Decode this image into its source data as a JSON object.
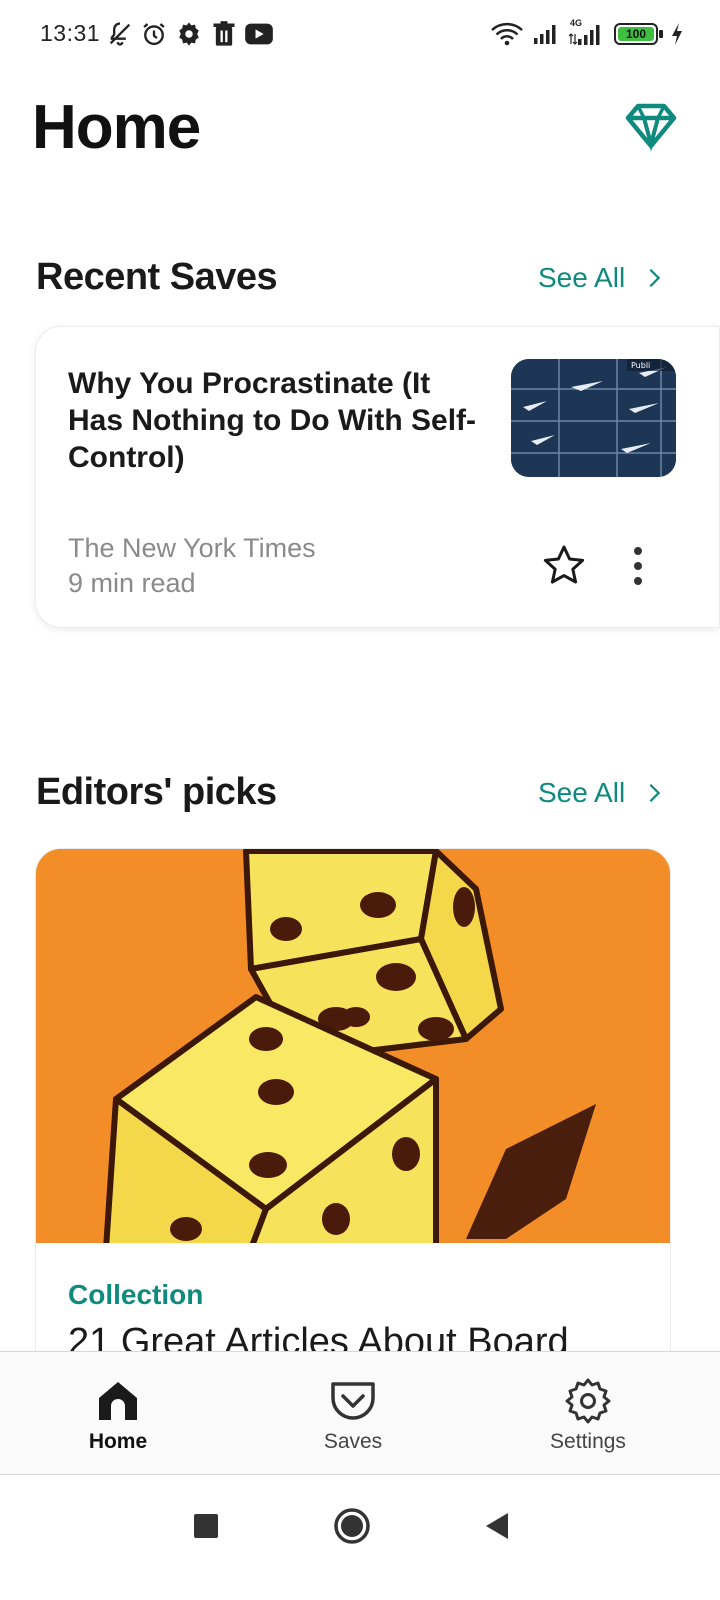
{
  "status_bar": {
    "time": "13:31",
    "battery": "100",
    "network": "4G",
    "icons": [
      "bell-off-icon",
      "alarm-icon",
      "settings-gear-icon",
      "trash-icon",
      "youtube-icon",
      "wifi-icon",
      "signal-icon",
      "signal-4g-icon",
      "battery-icon",
      "charging-icon"
    ]
  },
  "header": {
    "title": "Home",
    "premium_icon": "diamond-icon"
  },
  "recent_saves": {
    "title": "Recent Saves",
    "see_all": "See All",
    "item": {
      "title": "Why You Procrastinate (It Has Nothing to Do With Self-Control)",
      "source": "The New York Times",
      "read_time": "9 min read"
    }
  },
  "editors_picks": {
    "title": "Editors' picks",
    "see_all": "See All",
    "item": {
      "label": "Collection",
      "title": "21 Great Articles About Board"
    }
  },
  "bottom_nav": {
    "items": [
      {
        "label": "Home",
        "icon": "home-icon",
        "active": true
      },
      {
        "label": "Saves",
        "icon": "pocket-icon",
        "active": false
      },
      {
        "label": "Settings",
        "icon": "gear-icon",
        "active": false
      }
    ]
  },
  "colors": {
    "accent": "#0f8a7e",
    "pick_image_bg": "#f28d27",
    "thumb_bg": "#1d3656"
  }
}
